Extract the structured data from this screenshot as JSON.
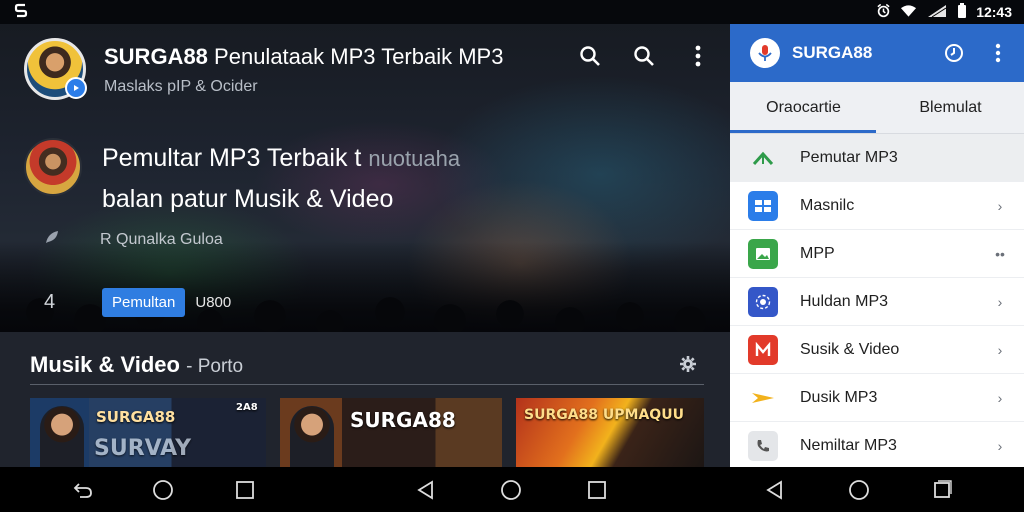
{
  "status_bar": {
    "left_icon": "app-logo-icon",
    "time": "12:43",
    "icons": [
      "alarm-icon",
      "wifi-icon",
      "signal-icon",
      "battery-icon"
    ]
  },
  "hero": {
    "app_name": "SURGA88",
    "title_rest": "Penulataak MP3 Terbaik MP3",
    "subtitle": "Maslaks pIP & Ocider",
    "actions": [
      "search-icon",
      "search-icon",
      "more-vert-icon"
    ],
    "featured": {
      "line1": "Pemultar MP3 Terbaik t",
      "line1_ghost": "nuotuaha",
      "line2": "balan patur Musik & Video"
    },
    "meta_text": "R Qunalka Guloa",
    "side_number": "4",
    "play_button": "Pemultan",
    "count": "U800"
  },
  "section": {
    "title": "Musik & Video",
    "title_sub": "- Porto",
    "cards": [
      {
        "title": "SURGA88",
        "subtitle": "SURVAY",
        "badge": "2A8"
      },
      {
        "title": "SURGA88"
      },
      {
        "title": "SURGA88 UPMAQUU"
      }
    ]
  },
  "panel": {
    "title": "SURGA88",
    "tabs": [
      "Oraocartie",
      "Blemulat"
    ],
    "active_tab": 0,
    "items": [
      {
        "label": "Pemutar MP3",
        "icon": "music-arrow-icon",
        "color": "#2e9b4a",
        "trailing": ""
      },
      {
        "label": "Masnilc",
        "icon": "grid-icon",
        "color": "#2b7de9",
        "trailing": "›"
      },
      {
        "label": "MPP",
        "icon": "image-icon",
        "color": "#3aa64a",
        "trailing": "••"
      },
      {
        "label": "Huldan MP3",
        "icon": "radio-icon",
        "color": "#3457c8",
        "trailing": "›"
      },
      {
        "label": "Susik & Video",
        "icon": "m-icon",
        "color": "#e23a2a",
        "trailing": "›"
      },
      {
        "label": "Dusik MP3",
        "icon": "play-arrow-icon",
        "color": "#f2b21c",
        "trailing": "›"
      },
      {
        "label": "Nemiltar MP3",
        "icon": "phone-icon",
        "color": "#555555",
        "trailing": "›"
      }
    ]
  },
  "colors": {
    "accent": "#2c6ac9",
    "play_button": "#2f7de1",
    "background": "#0b0f16"
  }
}
